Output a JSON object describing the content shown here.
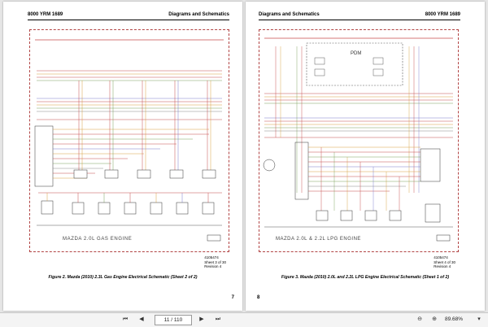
{
  "left_page": {
    "header_left": "8000 YRM 1689",
    "header_right": "Diagrams and Schematics",
    "schematic_title": "MAZDA 2.0L GAS ENGINE",
    "stamp": "4105474",
    "sheet": "Sheet 3 of 30",
    "revision": "Revision 4",
    "caption": "Figure 2. Mazda (2010) 2.3L Gas Engine Electrical Schematic (Sheet 2 of 2)",
    "page_number": "7"
  },
  "right_page": {
    "header_left": "Diagrams and Schematics",
    "header_right": "8000 YRM 1689",
    "schematic_title": "MAZDA 2.0L & 2.2L LPG ENGINE",
    "pdm_label": "PDM",
    "stamp": "4105474",
    "sheet": "Sheet 4 of 30",
    "revision": "Revision 4",
    "caption": "Figure 3. Mazda (2010) 2.0L and 2.2L LPG Engine Electrical Schematic (Sheet 1 of 2)",
    "page_number": "8"
  },
  "toolbar": {
    "first": "⏮",
    "prev": "◀",
    "page_field": "11 / 110",
    "next": "▶",
    "last": "⏭",
    "zoom_out": "⊖",
    "zoom_in": "⊕",
    "zoom_level": "89.68%",
    "menu": "▾"
  }
}
